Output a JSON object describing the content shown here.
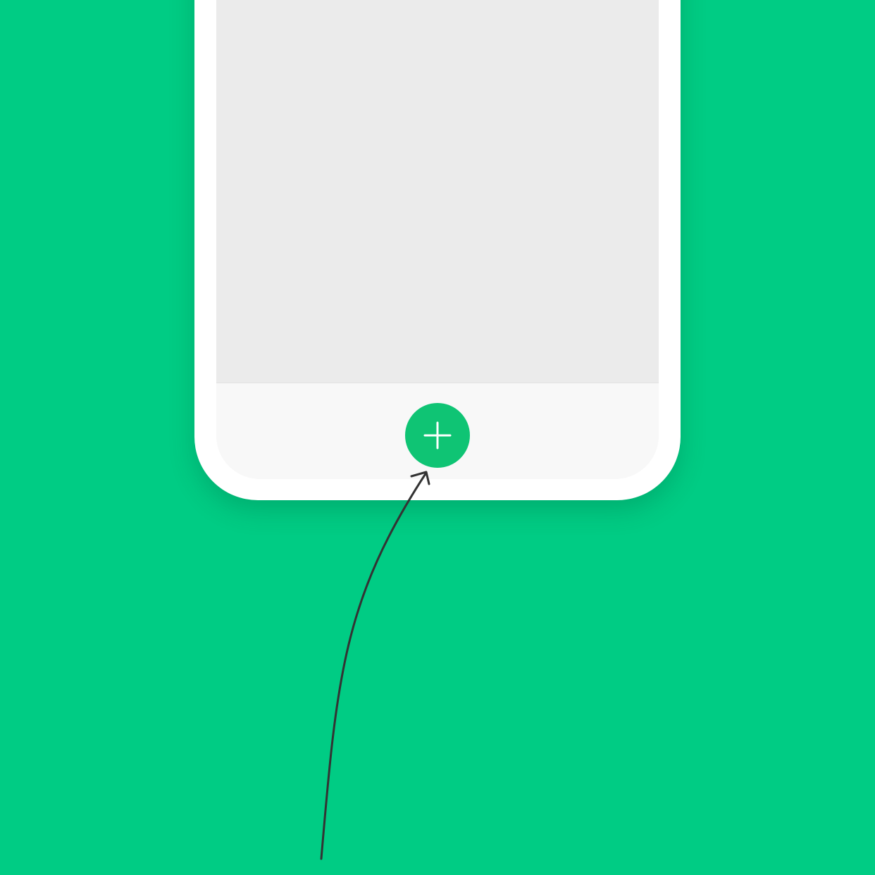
{
  "colors": {
    "background": "#00cc84",
    "device_frame": "#ffffff",
    "content_area": "#ebebeb",
    "bottom_bar": "#f8f8f8",
    "fab": "#0fc474",
    "fab_icon": "#ffffff",
    "arrow": "#333333"
  },
  "fab": {
    "icon": "plus-icon"
  },
  "annotation": {
    "icon": "arrow-icon"
  }
}
